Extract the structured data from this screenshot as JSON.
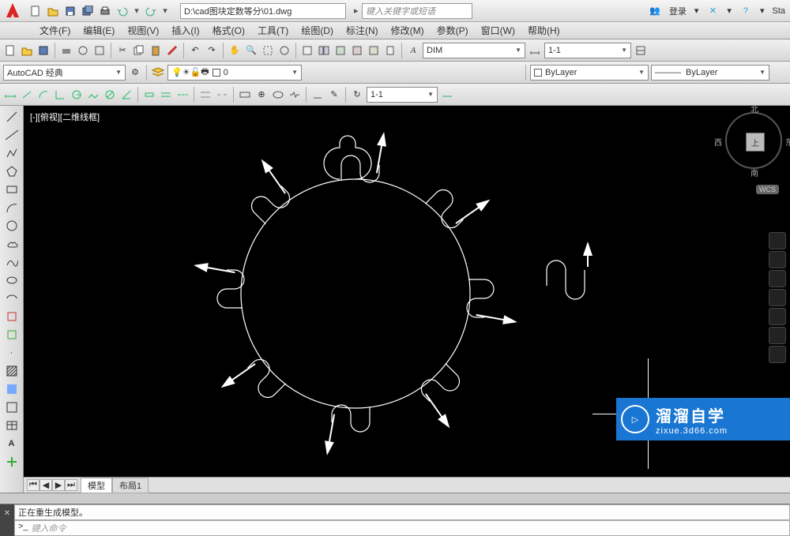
{
  "title_path": "D:\\cad图块定数等分\\01.dwg",
  "search_placeholder": "键入关键字或短语",
  "login_label": "登录",
  "star_label": "Sta",
  "menubar": {
    "file": "文件(F)",
    "edit": "编辑(E)",
    "view": "视图(V)",
    "insert": "插入(I)",
    "format": "格式(O)",
    "tools": "工具(T)",
    "draw": "绘图(D)",
    "dimension": "标注(N)",
    "modify": "修改(M)",
    "param": "参数(P)",
    "window": "窗口(W)",
    "help": "帮助(H)"
  },
  "workspace": "AutoCAD 经典",
  "layer_zero": "0",
  "dim_style": "DIM",
  "anno_scale": "1-1",
  "bylayer_color": "ByLayer",
  "bylayer_lt": "ByLayer",
  "viewport_scale": "1-1",
  "view_label": "[-][俯视][二维线框]",
  "navcube": {
    "top": "上",
    "n": "北",
    "s": "南",
    "e": "东",
    "w": "西"
  },
  "wcs": "WCS",
  "tabs": {
    "model": "模型",
    "layout1": "布局1"
  },
  "cmd_history": "正在重生成模型。",
  "cmd_prompt": "键入命令",
  "cmd_prefix": ">_",
  "watermark": {
    "brand": "溜溜自学",
    "site": "zixue.3d66.com",
    "icon": "▷"
  }
}
